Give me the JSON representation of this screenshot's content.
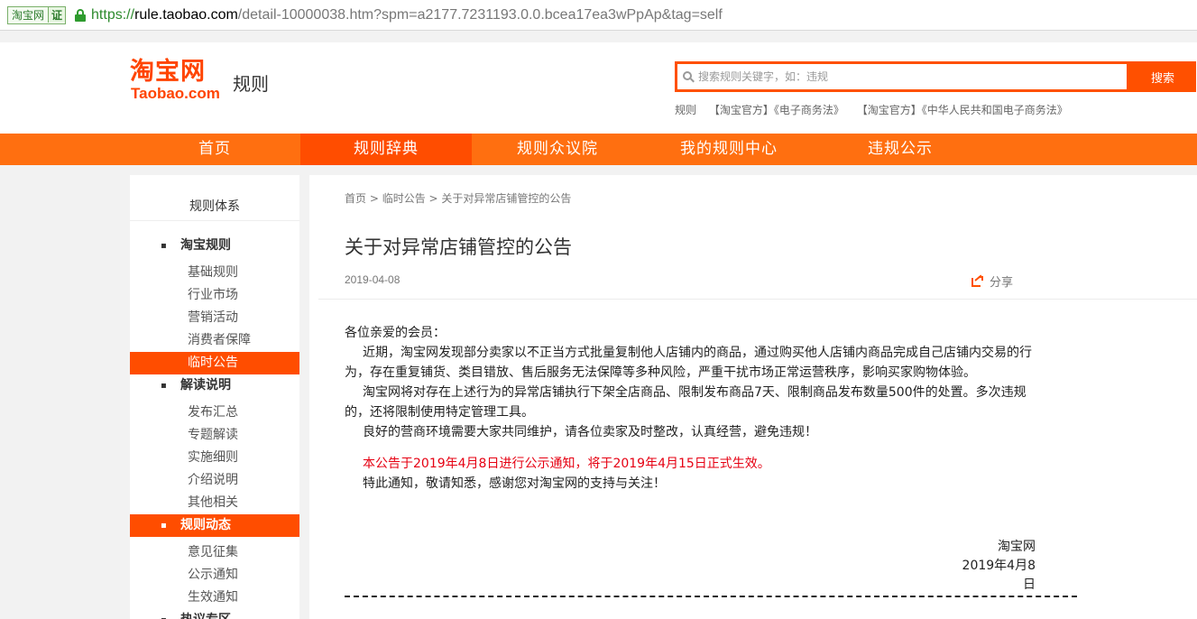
{
  "urlbar": {
    "site_name": "淘宝网",
    "cert_label": "证",
    "url_protocol": "https://",
    "url_host": "rule.taobao.com",
    "url_path": "/detail-10000038.htm?spm=a2177.7231193.0.0.bcea17ea3wPpAp&tag=self"
  },
  "header": {
    "logo_cn": "淘宝网",
    "logo_en": "Taobao.com",
    "logo_sub": "规则",
    "search_placeholder": "搜索规则关键字，如：违规",
    "search_button": "搜索",
    "hotwords": [
      "规则",
      "【淘宝官方】《电子商务法》",
      "【淘宝官方】《中华人民共和国电子商务法》"
    ]
  },
  "nav": {
    "items": [
      "首页",
      "规则辞典",
      "规则众议院",
      "我的规则中心",
      "违规公示"
    ],
    "active_index": 1
  },
  "sidebar": {
    "title": "规则体系",
    "groups": [
      {
        "label": "淘宝规则",
        "bullet": "▪",
        "items": [
          "基础规则",
          "行业市场",
          "营销活动",
          "消费者保障",
          "临时公告"
        ]
      },
      {
        "label": "解读说明",
        "bullet": "▪",
        "items": [
          "发布汇总",
          "专题解读",
          "实施细则",
          "介绍说明",
          "其他相关"
        ]
      },
      {
        "label": "规则动态",
        "bullet": "▪",
        "items": [
          "意见征集",
          "公示通知",
          "生效通知"
        ]
      },
      {
        "label": "热议专区",
        "bullet": "▪"
      }
    ]
  },
  "content": {
    "breadcrumb": [
      "首页",
      "临时公告",
      "关于对异常店铺管控的公告"
    ],
    "breadcrumb_sep": " > ",
    "title": "关于对异常店铺管控的公告",
    "date": "2019-04-08",
    "share_label": "分享",
    "greeting": "各位亲爱的会员：",
    "para1": "近期，淘宝网发现部分卖家以不正当方式批量复制他人店铺内的商品，通过购买他人店铺内商品完成自己店铺内交易的行为，存在重复铺货、类目错放、售后服务无法保障等多种风险，严重干扰市场正常运营秩序，影响买家购物体验。",
    "para2": "淘宝网将对存在上述行为的异常店铺执行下架全店商品、限制发布商品7天、限制商品发布数量500件的处置。多次违规的，还将限制使用特定管理工具。",
    "para3": "良好的营商环境需要大家共同维护，请各位卖家及时整改，认真经营，避免违规！",
    "notice_red": "本公告于2019年4月8日进行公示通知，将于2019年4月15日正式生效。",
    "closing": "特此通知，敬请知悉，感谢您对淘宝网的支持与关注！",
    "signature": "淘宝网",
    "sign_date": "2019年4月8日"
  },
  "colors": {
    "brand_orange": "#ff5000",
    "nav_bg": "#ff6f10",
    "nav_active": "#ff4d00",
    "notice_red": "#e60012"
  }
}
